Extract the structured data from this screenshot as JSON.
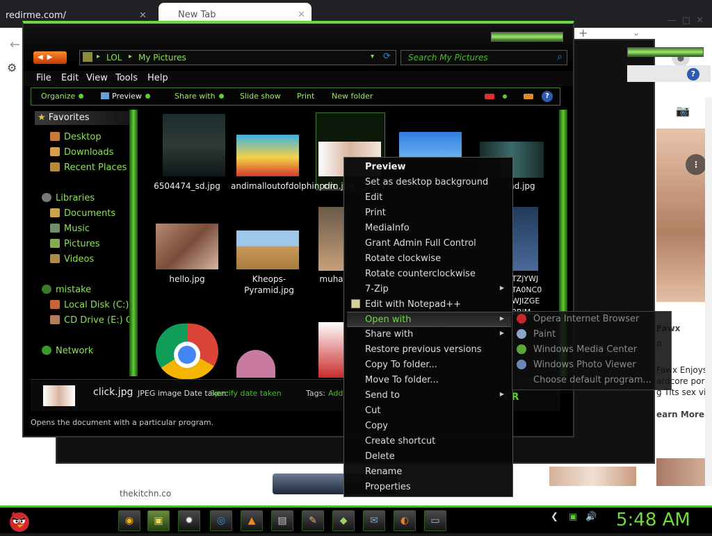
{
  "browser": {
    "tab1_title": "redirme.com/",
    "tab2_title": "New Tab",
    "close_glyph": "✕",
    "window_controls": "—□✕",
    "new_tab": "+",
    "chevron": "⌄",
    "back": "←",
    "settings": "⚙",
    "camera": "📷",
    "more": "⋮",
    "account_icon": "person-icon",
    "result_title": "Fawx",
    "result_sub": "n",
    "result_line1": "Fawx Enjoys",
    "result_line2": "ardcore porn",
    "result_line3": "g Tits sex vid",
    "learn_more": "earn More",
    "bottom_link": "thekitchn.co",
    "help": "?"
  },
  "explorer": {
    "address": {
      "segments": [
        "LOL",
        "My Pictures"
      ],
      "separator": "▸"
    },
    "search_placeholder": "Search My Pictures",
    "search_icon": "⌕",
    "refresh_icon": "⟳",
    "nav_arrows": "◀▶",
    "menu": [
      "File",
      "Edit",
      "View",
      "Tools",
      "Help"
    ],
    "toolbar": {
      "organize": "Organize",
      "preview": "Preview",
      "share_with": "Share with",
      "slide_show": "Slide show",
      "print": "Print",
      "new_folder": "New folder",
      "help": "?"
    },
    "nav": {
      "favorites": "Favorites",
      "desktop": "Desktop",
      "downloads": "Downloads",
      "recent_places": "Recent Places",
      "libraries": "Libraries",
      "documents": "Documents",
      "music": "Music",
      "pictures": "Pictures",
      "videos": "Videos",
      "mistake": "mistake",
      "local_disk": "Local Disk (C:)",
      "cd_drive": "CD Drive (E:) G",
      "network": "Network"
    },
    "files": [
      {
        "name": "6504474_sd.jpg"
      },
      {
        "name": "andimalloutofdolphinporn.jpg"
      },
      {
        "name": "clic"
      },
      {
        "name": ""
      },
      {
        "name": "ad.jpg"
      },
      {
        "name": "hello.jpg"
      },
      {
        "name": "Kheops-Pyramid.jpg"
      },
      {
        "name": "muhar"
      },
      {
        "name": "TZjYWJ\nTA0NC0\nWJIZGE\n2RiM..."
      }
    ],
    "details": {
      "name": "click.jpg",
      "type_label": "JPEG image Date taken:",
      "date_value": "Specify date taken",
      "tags_label": "Tags:",
      "tags_value": "Add"
    },
    "status_text": "Opens the document with a particular program.",
    "brand_fragment": "ER"
  },
  "context_menu": {
    "items": [
      {
        "label": "Preview",
        "bold": true
      },
      {
        "label": "Set as desktop background"
      },
      {
        "label": "Edit"
      },
      {
        "label": "Print"
      },
      {
        "label": "MediaInfo"
      },
      {
        "label": "Grant Admin Full Control"
      },
      {
        "label": "Rotate clockwise"
      },
      {
        "label": "Rotate counterclockwise"
      },
      {
        "label": "7-Zip",
        "submenu": true
      },
      {
        "label": "Edit with Notepad++"
      },
      {
        "label": "Open with",
        "submenu": true,
        "highlighted": true
      },
      {
        "label": "Share with",
        "submenu": true
      },
      {
        "label": "Restore previous versions"
      },
      {
        "label": "Copy To folder..."
      },
      {
        "label": "Move To folder..."
      },
      {
        "label": "Send to",
        "submenu": true
      },
      {
        "label": "Cut"
      },
      {
        "label": "Copy"
      },
      {
        "label": "Create shortcut"
      },
      {
        "label": "Delete"
      },
      {
        "label": "Rename"
      },
      {
        "label": "Properties"
      }
    ],
    "submenu_arrow": "▶",
    "highlight_color": "#6ddc3b"
  },
  "open_with_submenu": [
    {
      "label": "Opera Internet Browser",
      "icon": "opera-icon",
      "color": "#c8262b"
    },
    {
      "label": "Paint",
      "icon": "paint-icon",
      "color": "#8aa5c7"
    },
    {
      "label": "Windows Media Center",
      "icon": "media-center-icon",
      "color": "#5ba53a"
    },
    {
      "label": "Windows Photo Viewer",
      "icon": "photo-viewer-icon",
      "color": "#6b87b3"
    },
    {
      "label": "Choose default program...",
      "icon": "",
      "color": ""
    }
  ],
  "taskbar": {
    "clock": "5:48 AM",
    "accent": "#4dbb2d",
    "apps": [
      "chrome-icon",
      "explorer-icon",
      "spider-icon",
      "network-icon",
      "vlc-icon",
      "print-icon",
      "paint-icon",
      "files-icon",
      "chat-icon",
      "firefox-icon",
      "window-icon"
    ],
    "app_glyphs": [
      "◉",
      "▣",
      "✹",
      "◎",
      "▲",
      "▤",
      "✎",
      "◆",
      "✉",
      "◐",
      "▭"
    ],
    "tray": {
      "back": "❮",
      "net": "▣",
      "vol": "🔊"
    }
  }
}
